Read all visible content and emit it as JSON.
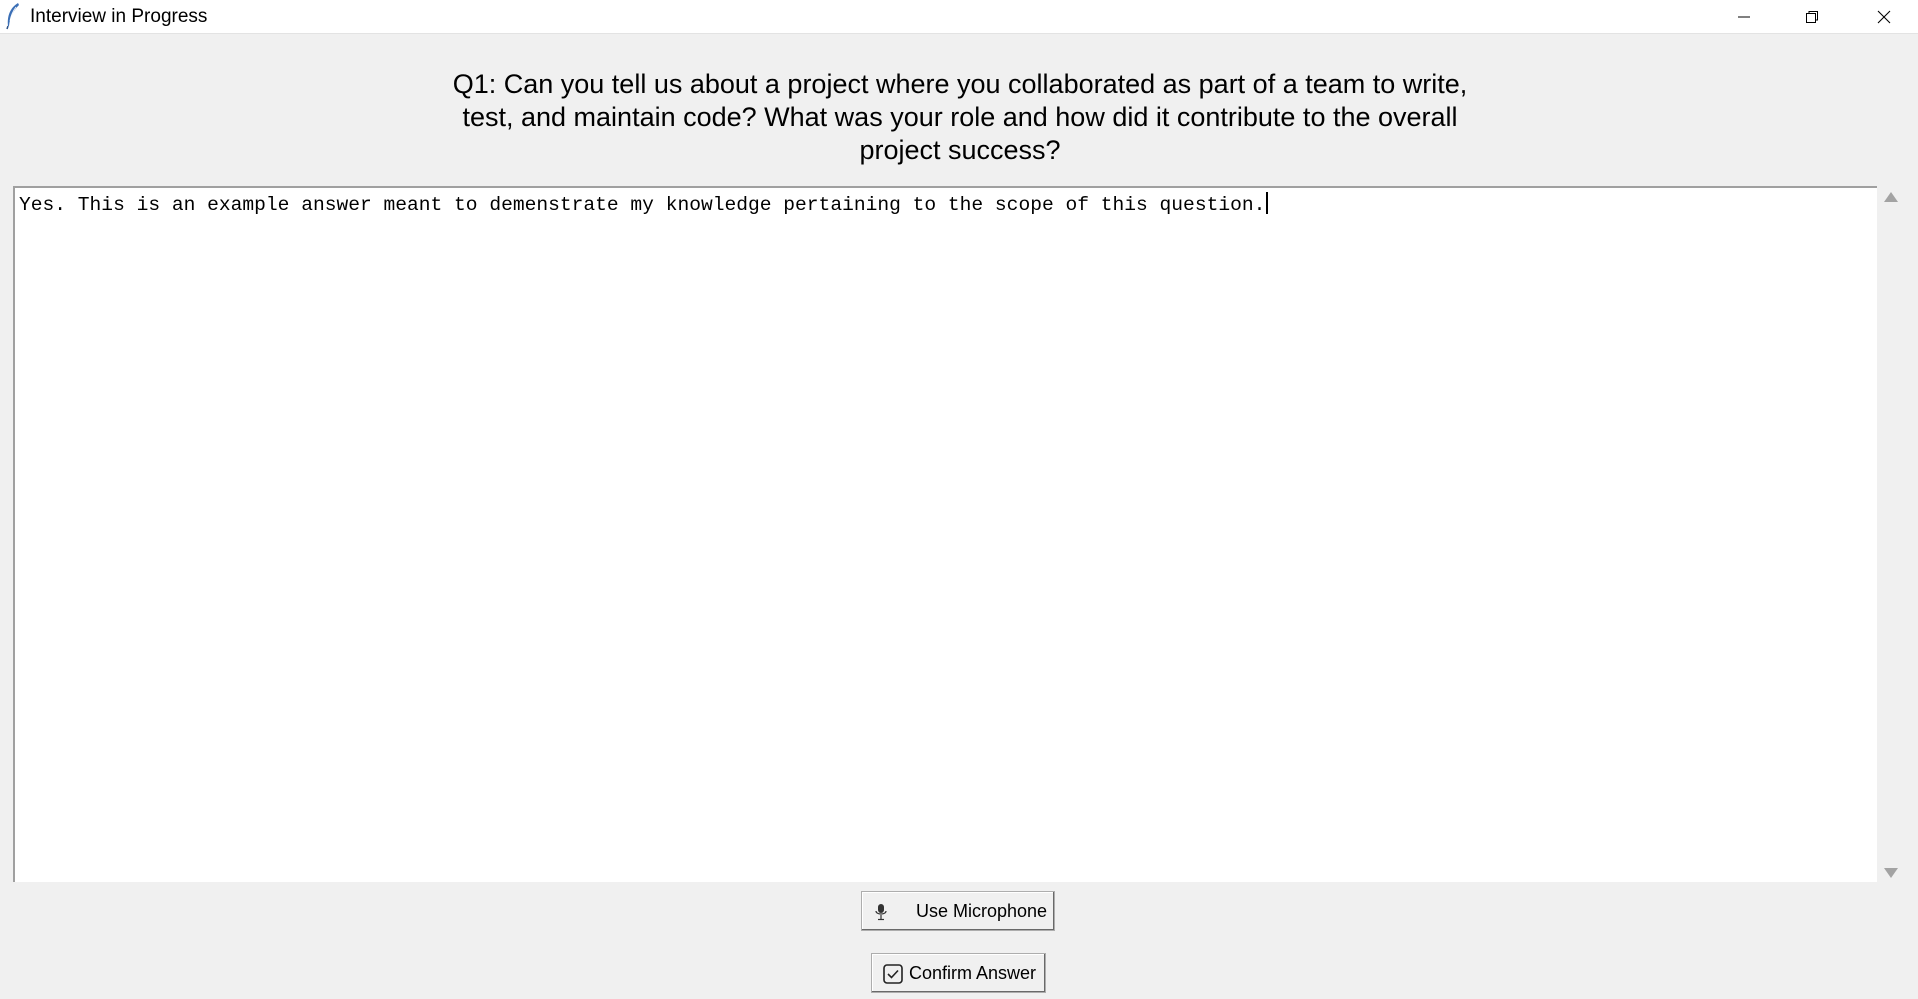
{
  "window": {
    "title": "Interview in Progress",
    "icons": {
      "app": "feather-icon",
      "minimize": "minimize-icon",
      "maximize": "restore-icon",
      "close": "close-icon"
    }
  },
  "question": {
    "text": "Q1: Can you tell us about a project where you collaborated as part of a team to write, test, and maintain code? What was your role and how did it contribute to the overall project success?"
  },
  "answer": {
    "text": "Yes. This is an example answer meant to demenstrate my knowledge pertaining to the scope of this question."
  },
  "buttons": {
    "microphone": {
      "label": "Use Microphone",
      "icon": "microphone-icon"
    },
    "confirm": {
      "label": "Confirm Answer",
      "icon": "checkbox-icon"
    }
  }
}
